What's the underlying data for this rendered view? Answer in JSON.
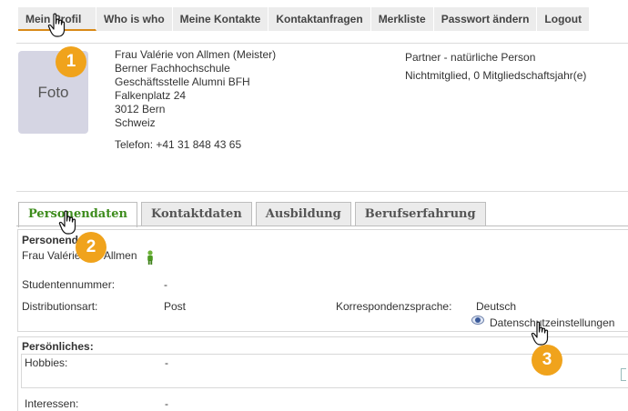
{
  "topnav": {
    "items": [
      "Mein Profil",
      "Who is who",
      "Meine Kontakte",
      "Kontaktanfragen",
      "Merkliste",
      "Passwort ändern",
      "Logout"
    ]
  },
  "profile": {
    "photo_label": "Foto",
    "address_lines": [
      "Frau Valérie von Allmen (Meister)",
      "Berner Fachhochschule",
      "Geschäftsstelle Alumni BFH",
      "Falkenplatz 24",
      "3012 Bern",
      "Schweiz"
    ],
    "phone": "Telefon: +41 31 848 43 65",
    "partner_type": "Partner - natürliche Person",
    "membership": "Nichtmitglied, 0 Mitgliedschaftsjahr(e)"
  },
  "tabs": [
    "Personendaten",
    "Kontaktdaten",
    "Ausbildung",
    "Berufserfahrung"
  ],
  "personal_data": {
    "section_label": "Personendaten:",
    "name": "Frau Valérie von Allmen",
    "student_number_label": "Studentennummer:",
    "student_number_value": "-",
    "distribution_label": "Distributionsart:",
    "distribution_value": "Post",
    "language_label": "Korrespondenzsprache:",
    "language_value": "Deutsch",
    "privacy_link": "Datenschutzeinstellungen"
  },
  "personal_info": {
    "section_label": "Persönliches:",
    "hobbies_label": "Hobbies:",
    "hobbies_value": "-",
    "interests_label": "Interessen:",
    "interests_value": "-"
  },
  "callouts": [
    "1",
    "2",
    "3"
  ],
  "colors": {
    "accent_orange": "#f0a31c",
    "active_tab_green": "#3d8c1c",
    "nav_bg": "#ececec"
  }
}
